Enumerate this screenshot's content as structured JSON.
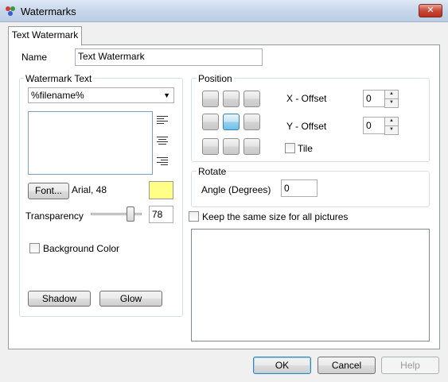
{
  "window": {
    "title": "Watermarks"
  },
  "tabs": [
    {
      "label": "Text Watermark"
    }
  ],
  "name": {
    "label": "Name",
    "value": "Text Watermark"
  },
  "watermark_text": {
    "group_label": "Watermark Text",
    "dropdown_value": "%filename%",
    "text_value": "",
    "font_button": "Font...",
    "font_desc": "Arial, 48",
    "color": "#ffff88",
    "transparency_label": "Transparency",
    "transparency_value": "78",
    "background_color_label": "Background Color",
    "shadow_button": "Shadow",
    "glow_button": "Glow"
  },
  "position": {
    "group_label": "Position",
    "x_offset_label": "X - Offset",
    "x_offset_value": "0",
    "y_offset_label": "Y - Offset",
    "y_offset_value": "0",
    "tile_label": "Tile",
    "selected": "middle-center"
  },
  "rotate": {
    "group_label": "Rotate",
    "angle_label": "Angle (Degrees)",
    "angle_value": "0"
  },
  "keep_size_label": "Keep the same size for all pictures",
  "buttons": {
    "ok": "OK",
    "cancel": "Cancel",
    "help": "Help"
  }
}
